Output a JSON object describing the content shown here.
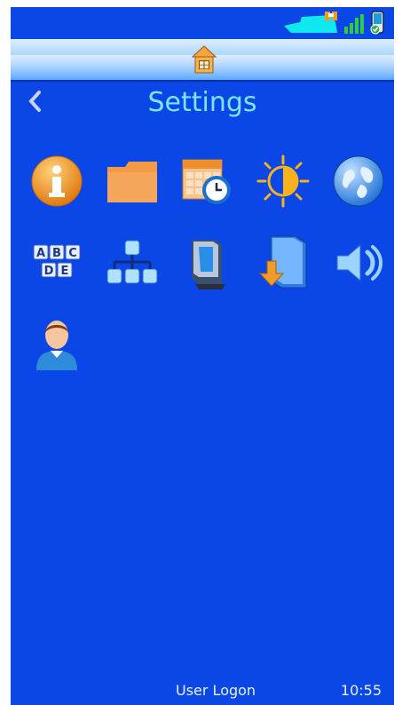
{
  "title": "Settings",
  "footer": {
    "logon_label": "User Logon",
    "time": "10:55"
  },
  "status_icons": [
    "banner-icon",
    "signal-bars-icon",
    "remote-device-icon"
  ],
  "settings_icons": [
    "info-icon",
    "folder-icon",
    "calendar-clock-icon",
    "brightness-icon",
    "globe-icon",
    "abcde-keyboard-icon",
    "network-hierarchy-icon",
    "printer-icon",
    "download-icon",
    "speaker-icon",
    "user-icon"
  ]
}
